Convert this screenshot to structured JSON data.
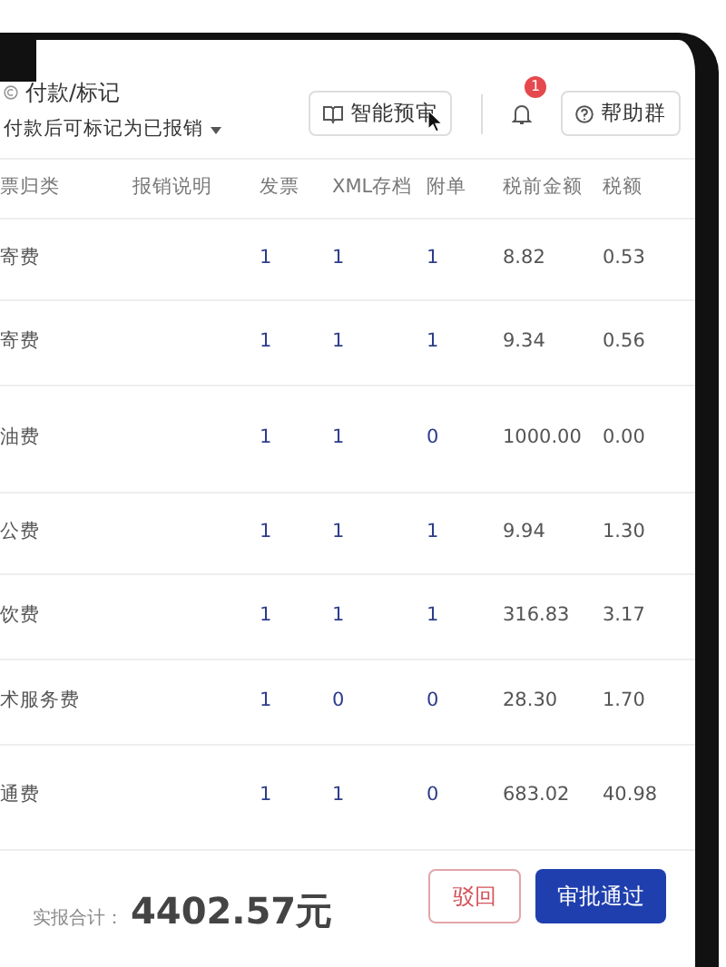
{
  "header": {
    "title": "付款/标记",
    "subtitle": "付款后可标记为已报销",
    "preview_button": {
      "label": "智能预审"
    },
    "notifications": {
      "count": "1"
    },
    "help_button": {
      "label": "帮助群"
    }
  },
  "table": {
    "columns": [
      "票归类",
      "报销说明",
      "发票",
      "XML存档",
      "附单",
      "税前金额",
      "税额"
    ],
    "rows": [
      {
        "category": "寄费",
        "invoice": "1",
        "xml": "1",
        "attachment": "1",
        "pre_tax": "8.82",
        "tax": "0.53"
      },
      {
        "category": "寄费",
        "invoice": "1",
        "xml": "1",
        "attachment": "1",
        "pre_tax": "9.34",
        "tax": "0.56"
      },
      {
        "category": "油费",
        "invoice": "1",
        "xml": "1",
        "attachment": "0",
        "pre_tax": "1000.00",
        "tax": "0.00"
      },
      {
        "category": "公费",
        "invoice": "1",
        "xml": "1",
        "attachment": "1",
        "pre_tax": "9.94",
        "tax": "1.30"
      },
      {
        "category": "饮费",
        "invoice": "1",
        "xml": "1",
        "attachment": "1",
        "pre_tax": "316.83",
        "tax": "3.17"
      },
      {
        "category": "术服务费",
        "invoice": "1",
        "xml": "0",
        "attachment": "0",
        "pre_tax": "28.30",
        "tax": "1.70"
      },
      {
        "category": "通费",
        "invoice": "1",
        "xml": "1",
        "attachment": "0",
        "pre_tax": "683.02",
        "tax": "40.98"
      }
    ]
  },
  "footer": {
    "total_label": "实报合计：",
    "total": "4402.57元",
    "reject_button": "驳回",
    "approve_button": "审批通过"
  }
}
